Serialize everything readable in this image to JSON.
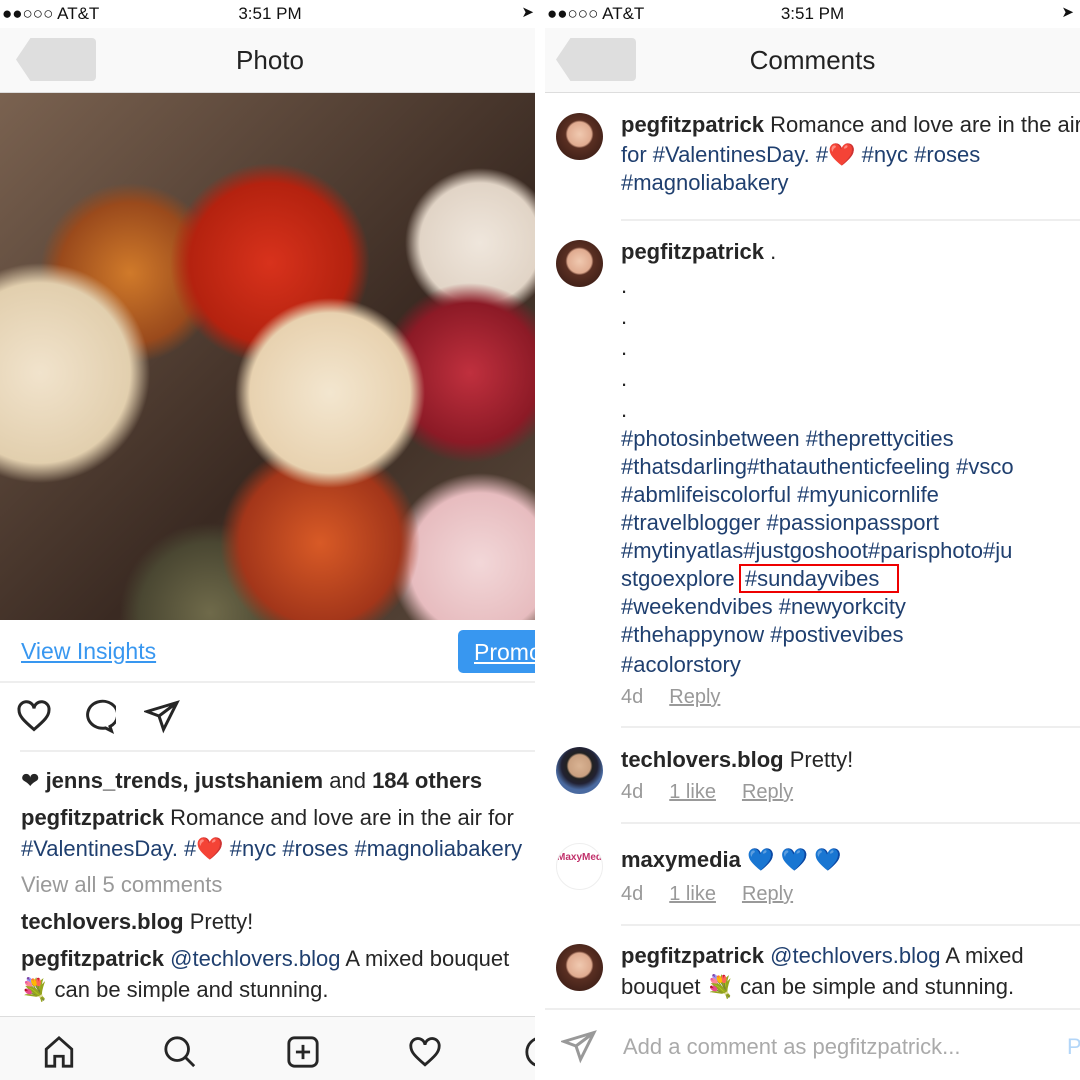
{
  "status": {
    "carrier": "●●○○○ AT&T",
    "time": "3:51 PM",
    "location_icon": "location-arrow-icon"
  },
  "left": {
    "title": "Photo",
    "view_insights": "View Insights",
    "promote": "Promote",
    "likes": {
      "users": "jenns_trends, justshaniem",
      "and": "and",
      "others": "184 others"
    },
    "caption": {
      "user": "pegfitzpatrick",
      "text": "Romance and love are in the air for",
      "line2_tags": "#ValentinesDay. #❤️  #nyc #roses #magnoliabakery"
    },
    "view_all": "View all 5 comments",
    "comment1": {
      "user": "techlovers.blog",
      "text": "Pretty!"
    },
    "comment2": {
      "user": "pegfitzpatrick",
      "mention": "@techlovers.blog",
      "text": "A mixed bouquet",
      "line2": "💐  can be simple and stunning."
    },
    "tabs": [
      "home-icon",
      "search-icon",
      "add-icon",
      "heart-icon",
      "profile-icon"
    ]
  },
  "right": {
    "title": "Comments",
    "comments": [
      {
        "user": "pegfitzpatrick",
        "text": "Romance and love are in the air",
        "line2": "for #ValentinesDay. #❤️  #nyc #roses",
        "line3": "#magnoliabakery"
      },
      {
        "user": "pegfitzpatrick",
        "text": ".",
        "dots": [
          ".",
          ".",
          ".",
          ".",
          "."
        ],
        "tag_lines": [
          "#photosinbetween #theprettycities",
          "#thatsdarling#thatauthenticfeeling #vsco",
          "#abmlifeiscolorful #myunicornlife",
          "#travelblogger  #passionpassport",
          "#mytinyatlas#justgoshoot#parisphoto#ju"
        ],
        "tag_line_split": {
          "before": "stgoexplore ",
          "highlighted": "#sundayvibes"
        },
        "tag_lines_after": [
          "#weekendvibes #newyorkcity",
          "#thehappynow #postivevibes",
          "#acolorstory"
        ],
        "time": "4d",
        "reply": "Reply"
      },
      {
        "user": "techlovers.blog",
        "text": "Pretty!",
        "time": "4d",
        "likes": "1 like",
        "reply": "Reply"
      },
      {
        "user": "maxymedia",
        "text": "💙 💙 💙",
        "avatar_text": "MaxyMedia",
        "time": "4d",
        "likes": "1 like",
        "reply": "Reply"
      },
      {
        "user": "pegfitzpatrick",
        "mention": "@techlovers.blog",
        "text": "A mixed",
        "line2": "bouquet 💐  can be simple and stunning."
      }
    ],
    "add_comment_placeholder": "Add a comment as pegfitzpatrick...",
    "post": "Post"
  },
  "colors": {
    "link_blue": "#3897f0",
    "hashtag": "#1f3f6f",
    "highlight": "#e00000"
  }
}
